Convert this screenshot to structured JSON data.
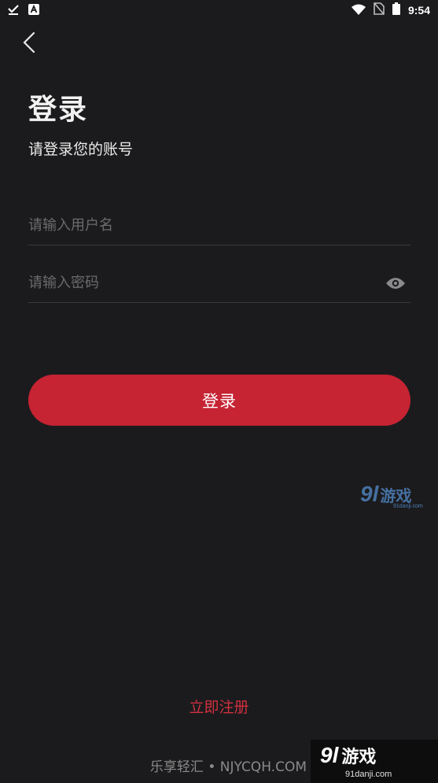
{
  "status_bar": {
    "time": "9:54",
    "left_icons": [
      "check-download-icon",
      "a-notification-icon"
    ],
    "right_icons": [
      "wifi-icon",
      "no-sim-icon",
      "battery-icon"
    ]
  },
  "header": {
    "back_icon": "chevron-left-icon",
    "title": "登录",
    "subtitle": "请登录您的账号"
  },
  "form": {
    "username": {
      "value": "",
      "placeholder": "请输入用户名"
    },
    "password": {
      "value": "",
      "placeholder": "请输入密码",
      "toggle_icon": "eye-icon"
    },
    "submit_label": "登录"
  },
  "register_label": "立即注册",
  "watermarks": {
    "mid_logo_num": "9l",
    "mid_logo_text": "游戏",
    "mid_logo_url": "91danji.com",
    "footer_text": "乐享轻汇 • NJYCQH.COM",
    "footer_logo_num": "9l",
    "footer_logo_text": "游戏",
    "footer_logo_url": "91danji.com"
  },
  "colors": {
    "background": "#1b1b1d",
    "accent": "#c62333",
    "register_link": "#d0303f",
    "divider": "#3a3a3c",
    "placeholder": "#6b6b6e"
  }
}
